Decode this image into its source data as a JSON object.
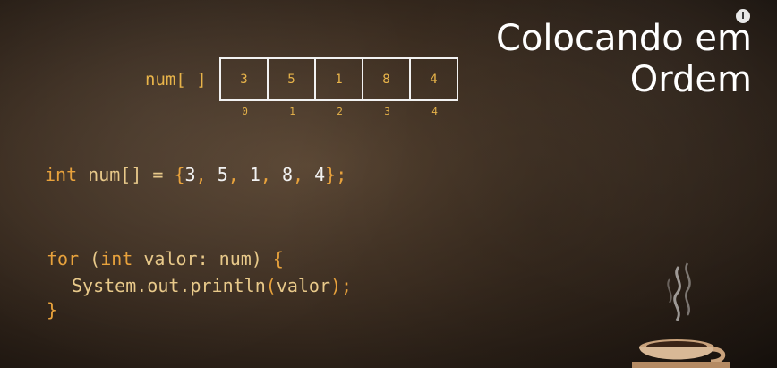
{
  "title": {
    "line1": "Colocando em",
    "line2": "Ordem"
  },
  "array": {
    "label": "num[ ]",
    "values": [
      "3",
      "5",
      "1",
      "8",
      "4"
    ],
    "indices": [
      "0",
      "1",
      "2",
      "3",
      "4"
    ]
  },
  "code": {
    "decl": {
      "type": "int",
      "name": " num[] = ",
      "open": "{",
      "v0": "3",
      "sep": ", ",
      "v1": "5",
      "v2": "1",
      "v3": "8",
      "v4": "4",
      "close": "};"
    },
    "for_line": {
      "kw_for": "for",
      "open": " (",
      "kw_int": "int",
      "rest": " valor: num) ",
      "brace": "{"
    },
    "print_line": {
      "call": "System.out.println",
      "open": "(",
      "arg": "valor",
      "close": ");"
    },
    "end_line": "}"
  },
  "icons": {
    "info": "info-icon",
    "coffee": "coffee-cup-icon"
  }
}
